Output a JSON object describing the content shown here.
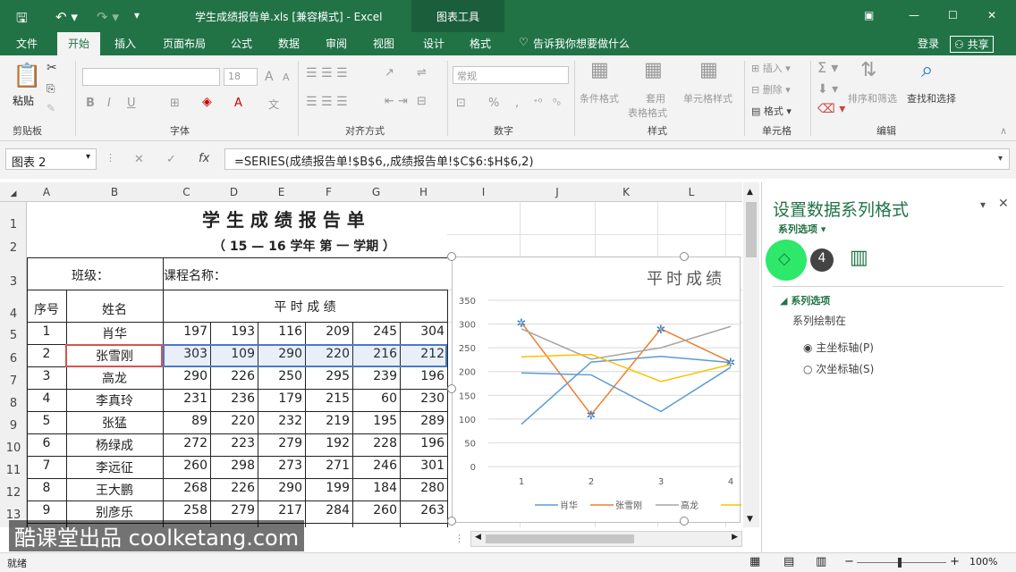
{
  "window": {
    "title": "学生成绩报告单.xls  [兼容模式] - Excel",
    "context_tab": "图表工具"
  },
  "tabs": [
    "文件",
    "开始",
    "插入",
    "页面布局",
    "公式",
    "数据",
    "审阅",
    "视图",
    "设计",
    "格式"
  ],
  "tell_me": "告诉我你想要做什么",
  "account": {
    "login": "登录",
    "share": "共享"
  },
  "ribbon": {
    "clipboard": {
      "paste": "粘贴",
      "group": "剪贴板"
    },
    "font": {
      "size": "18",
      "group": "字体",
      "bold": "B",
      "italic": "I",
      "underline": "U",
      "bigger": "A",
      "smaller": "A"
    },
    "alignment": {
      "group": "对齐方式"
    },
    "number": {
      "format": "常规",
      "percent": "%",
      "group": "数字"
    },
    "styles": {
      "conditional": "条件格式",
      "table": "套用",
      "table2": "表格格式",
      "cell": "单元格样式",
      "group": "样式"
    },
    "cells": {
      "insert": "插入",
      "delete": "删除",
      "format": "格式",
      "group": "单元格"
    },
    "editing": {
      "sort": "排序和筛选",
      "find": "查找和选择",
      "group": "编辑"
    }
  },
  "formula_bar": {
    "name": "图表 2",
    "fx": "fx",
    "formula": "=SERIES(成绩报告单!$B$6,,成绩报告单!$C$6:$H$6,2)"
  },
  "columns": [
    "A",
    "B",
    "C",
    "D",
    "E",
    "F",
    "G",
    "H",
    "I",
    "J",
    "K",
    "L"
  ],
  "rows": [
    "1",
    "2",
    "3",
    "4",
    "5",
    "6",
    "7",
    "8",
    "9",
    "10",
    "11",
    "12",
    "13"
  ],
  "sheet": {
    "title": "学 生 成 绩 报 告 单",
    "subtitle": "（ 15 — 16    学年 第 一 学期 ）",
    "class_label": "班级：",
    "course_label": "课程名称：",
    "col_seq": "序号",
    "col_name": "姓名",
    "col_scores": "平 时 成 绩",
    "students": [
      {
        "seq": "1",
        "name": "肖华",
        "scores": [
          "197",
          "193",
          "116",
          "209",
          "245",
          "304"
        ]
      },
      {
        "seq": "2",
        "name": "张雪刚",
        "scores": [
          "303",
          "109",
          "290",
          "220",
          "216",
          "212"
        ]
      },
      {
        "seq": "3",
        "name": "高龙",
        "scores": [
          "290",
          "226",
          "250",
          "295",
          "239",
          "196"
        ]
      },
      {
        "seq": "4",
        "name": "李真玲",
        "scores": [
          "231",
          "236",
          "179",
          "215",
          "60",
          "230"
        ]
      },
      {
        "seq": "5",
        "name": "张猛",
        "scores": [
          "89",
          "220",
          "232",
          "219",
          "195",
          "289"
        ]
      },
      {
        "seq": "6",
        "name": "杨绿成",
        "scores": [
          "272",
          "223",
          "279",
          "192",
          "228",
          "196"
        ]
      },
      {
        "seq": "7",
        "name": "李远征",
        "scores": [
          "260",
          "298",
          "273",
          "271",
          "246",
          "301"
        ]
      },
      {
        "seq": "8",
        "name": "王大鹏",
        "scores": [
          "268",
          "226",
          "290",
          "199",
          "184",
          "280"
        ]
      },
      {
        "seq": "9",
        "name": "别彦乐",
        "scores": [
          "258",
          "279",
          "217",
          "284",
          "260",
          "263"
        ]
      }
    ]
  },
  "chart_data": {
    "type": "line",
    "title": "平时成绩",
    "categories": [
      "1",
      "2",
      "3",
      "4"
    ],
    "ylim": [
      0,
      350
    ],
    "yticks": [
      "0",
      "50",
      "100",
      "150",
      "200",
      "250",
      "300",
      "350"
    ],
    "series": [
      {
        "name": "肖华",
        "color": "#5b9bd5",
        "values": [
          89,
          220,
          232,
          219
        ]
      },
      {
        "name": "张雪刚",
        "color": "#ed7d31",
        "values": [
          303,
          109,
          290,
          220
        ]
      },
      {
        "name": "高龙",
        "color": "#a5a5a5",
        "values": [
          290,
          226,
          250,
          295
        ]
      },
      {
        "name": "",
        "color": "#ffc000",
        "values": [
          231,
          236,
          179,
          215
        ]
      },
      {
        "name": "",
        "color": "#5b9bd5",
        "values": [
          197,
          193,
          116,
          209
        ]
      }
    ]
  },
  "pane": {
    "title": "设置数据系列格式",
    "subtitle": "系列选项",
    "badge": "4",
    "section": "系列选项",
    "plot_on": "系列绘制在",
    "primary": "主坐标轴(P)",
    "secondary": "次坐标轴(S)"
  },
  "status": {
    "ready": "就绪",
    "zoom": "100%"
  },
  "watermark": "酷课堂出品 coolketang.com"
}
